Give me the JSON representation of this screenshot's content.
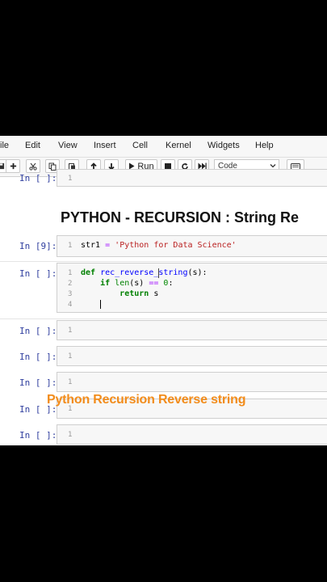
{
  "menu": [
    "ile",
    "Edit",
    "View",
    "Insert",
    "Cell",
    "Kernel",
    "Widgets",
    "Help"
  ],
  "toolbar": {
    "run_label": "Run",
    "cell_type": "Code"
  },
  "cells": {
    "top_partial": {
      "prompt": "In [ ]:",
      "line": "1"
    },
    "markdown_heading": "PYTHON - RECURSION : String Re",
    "cell1": {
      "prompt": "In [9]:",
      "lines": [
        "1"
      ],
      "code": [
        "str1 = 'Python for Data Science'"
      ]
    },
    "cell2": {
      "prompt": "In [ ]:",
      "lines": [
        "1",
        "2",
        "3",
        "4"
      ]
    },
    "empty_cells": [
      {
        "prompt": "In [ ]:",
        "line": "1"
      },
      {
        "prompt": "In [ ]:",
        "line": "1"
      },
      {
        "prompt": "In [ ]:",
        "line": "1"
      },
      {
        "prompt": "In [ ]:",
        "line": "1"
      },
      {
        "prompt": "In [ ]:",
        "line": "1"
      }
    ]
  },
  "overlay_caption": "Python Recursion Reverse string",
  "colors": {
    "caption": "#f28c1b",
    "prompt": "#303f9f"
  }
}
